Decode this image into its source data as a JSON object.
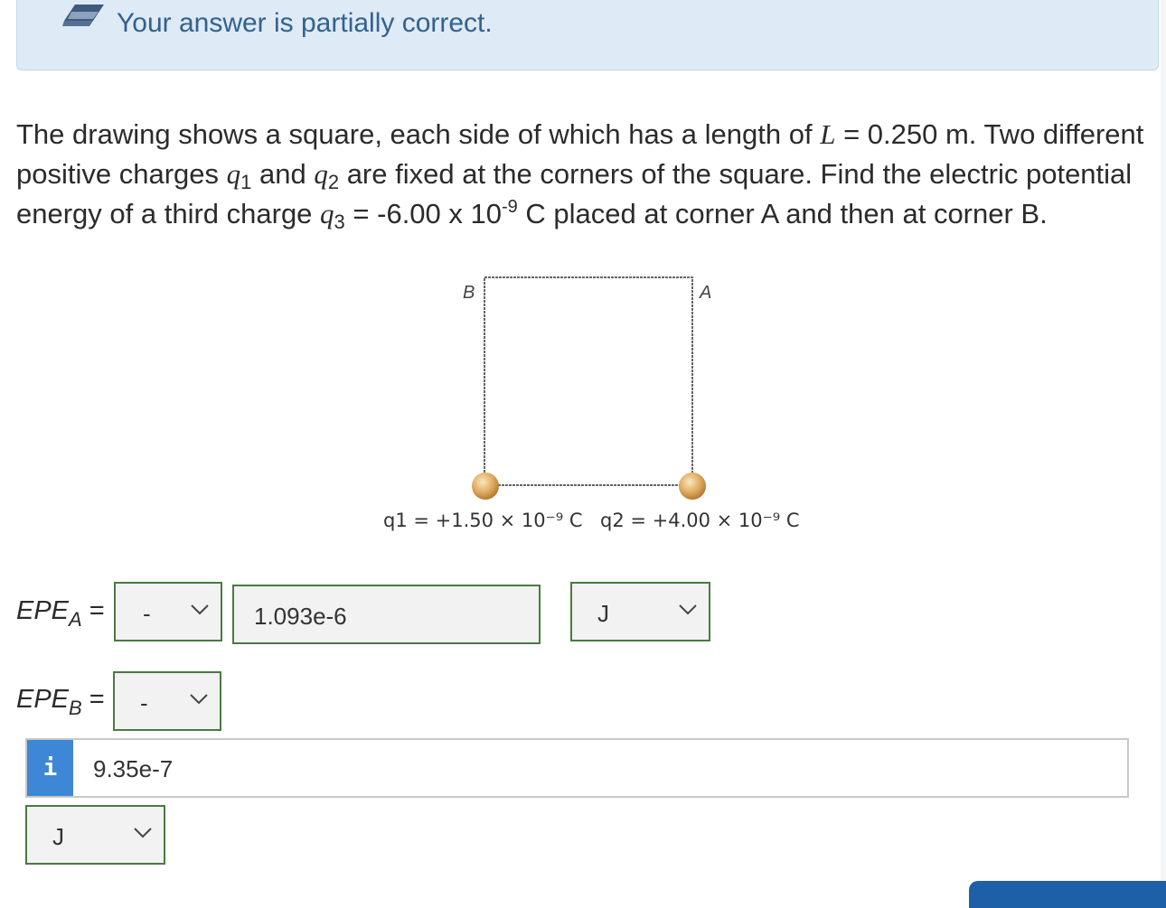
{
  "banner": {
    "message": "Your answer is partially correct.",
    "icon": "pencil-eraser-icon"
  },
  "question": {
    "text_1": "The drawing shows a square, each side of which has a length of ",
    "L_var": "L",
    "text_2": " = 0.250 m. Two different positive charges ",
    "q_letter": "q",
    "sub_1": "1",
    "text_3": " and ",
    "sub_2": "2",
    "text_4": " are fixed at the corners of the square. Find the electric potential energy of a third charge ",
    "sub_3": "3",
    "text_5": " = -6.00 x 10",
    "exp": "-9",
    "text_6": " C placed at corner A and then at corner B."
  },
  "figure": {
    "corner_b": "B",
    "corner_a": "A",
    "q1_label": "q1 = +1.50 × 10⁻⁹ C",
    "q2_label": "q2 = +4.00 × 10⁻⁹ C",
    "charge_color": "#d9a35a"
  },
  "answers": {
    "epe_a": {
      "label_main": "EPE",
      "label_sub": "A",
      "label_eq": " =",
      "sign": "-",
      "value": "1.093e-6",
      "unit": "J"
    },
    "epe_b": {
      "label_main": "EPE",
      "label_sub": "B",
      "label_eq": " =",
      "sign": "-",
      "info_icon": "i",
      "value": "9.35e-7",
      "unit": "J"
    }
  },
  "colors": {
    "banner_bg": "#deeaf6",
    "banner_text": "#33618e",
    "correct_border": "#4a7a42",
    "info_blue": "#3e87d6"
  }
}
